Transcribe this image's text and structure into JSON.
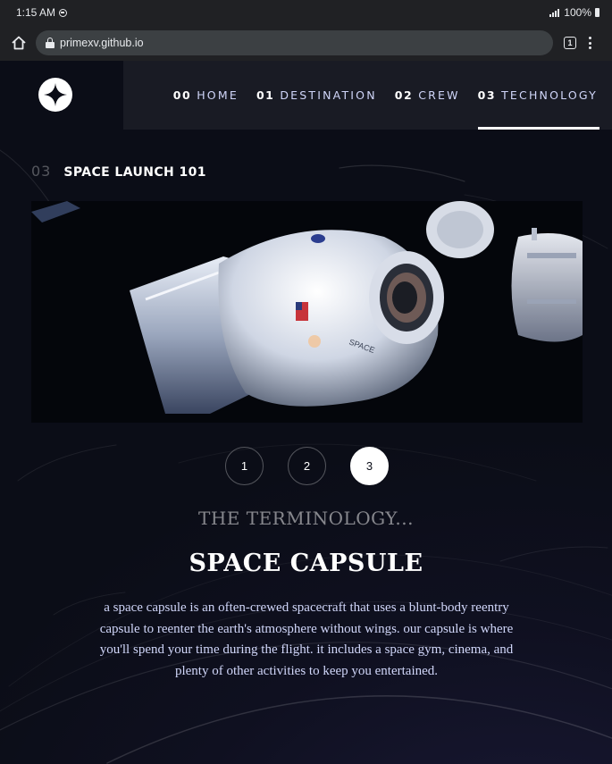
{
  "status_bar": {
    "time": "1:15 AM",
    "battery": "100%",
    "icons": [
      "notification-dot-icon",
      "signal-icon",
      "battery-icon"
    ]
  },
  "browser": {
    "url": "primexv.github.io",
    "tab_count": "1",
    "icons": [
      "home-icon",
      "lock-icon",
      "tabs-icon",
      "overflow-menu-icon"
    ]
  },
  "nav": {
    "logo_icon": "star-logo-icon",
    "items": [
      {
        "num": "00",
        "label": "HOME",
        "active": false
      },
      {
        "num": "01",
        "label": "DESTINATION",
        "active": false
      },
      {
        "num": "02",
        "label": "CREW",
        "active": false
      },
      {
        "num": "03",
        "label": "TECHNOLOGY",
        "active": true
      }
    ]
  },
  "section": {
    "number": "03",
    "title": "SPACE LAUNCH 101"
  },
  "slider": {
    "buttons": [
      "1",
      "2",
      "3"
    ],
    "active_index": 3
  },
  "technology": {
    "kicker": "THE TERMINOLOGY...",
    "name": "SPACE CAPSULE",
    "description": "a space capsule is an often-crewed spacecraft that uses a blunt-body reentry capsule to reenter the earth's atmosphere without wings. our capsule is where you'll spend your time during the flight. it includes a space gym, cinema, and plenty of other activities to keep you entertained."
  },
  "colors": {
    "background": "#0b0d17",
    "nav_text": "#d0d6f9",
    "white": "#ffffff",
    "browser_chrome": "#202124"
  }
}
